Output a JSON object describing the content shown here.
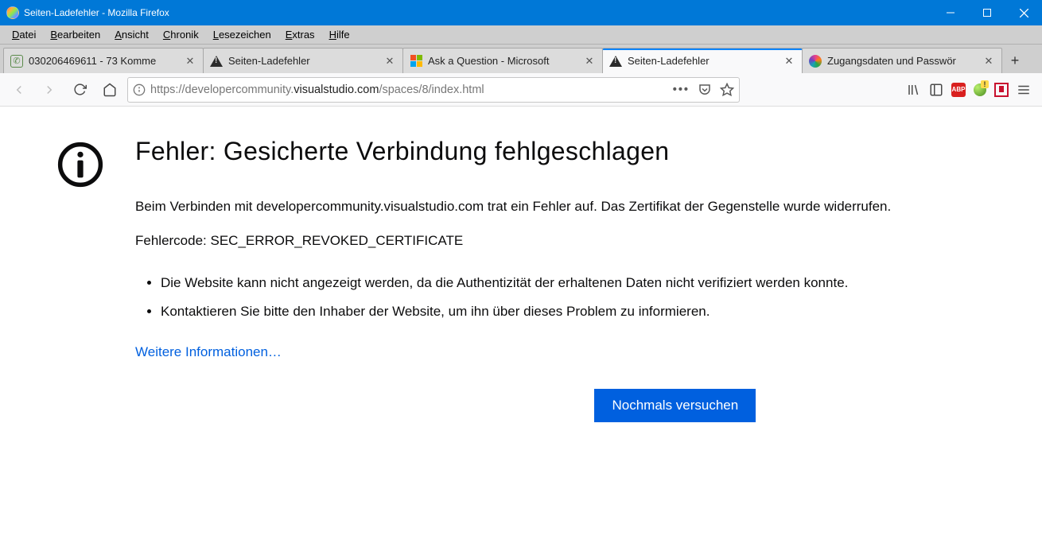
{
  "window": {
    "title": "Seiten-Ladefehler - Mozilla Firefox"
  },
  "menu": {
    "datei": "Datei",
    "bearbeiten": "Bearbeiten",
    "ansicht": "Ansicht",
    "chronik": "Chronik",
    "lesezeichen": "Lesezeichen",
    "extras": "Extras",
    "hilfe": "Hilfe"
  },
  "tabs": [
    {
      "title": "030206469611 - 73 Komme"
    },
    {
      "title": "Seiten-Ladefehler"
    },
    {
      "title": "Ask a Question - Microsoft"
    },
    {
      "title": "Seiten-Ladefehler"
    },
    {
      "title": "Zugangsdaten und Passwör"
    }
  ],
  "url": {
    "prefix": "https://developercommunity.",
    "host": "visualstudio.com",
    "path": "/spaces/8/index.html"
  },
  "error": {
    "title": "Fehler: Gesicherte Verbindung fehlgeschlagen",
    "desc": "Beim Verbinden mit developercommunity.visualstudio.com trat ein Fehler auf. Das Zertifikat der Gegenstelle wurde widerrufen.",
    "code": "Fehlercode: SEC_ERROR_REVOKED_CERTIFICATE",
    "bullet1": "Die Website kann nicht angezeigt werden, da die Authentizität der erhaltenen Daten nicht verifiziert werden konnte.",
    "bullet2": "Kontaktieren Sie bitte den Inhaber der Website, um ihn über dieses Problem zu informieren.",
    "more": "Weitere Informationen…",
    "retry": "Nochmals versuchen"
  }
}
